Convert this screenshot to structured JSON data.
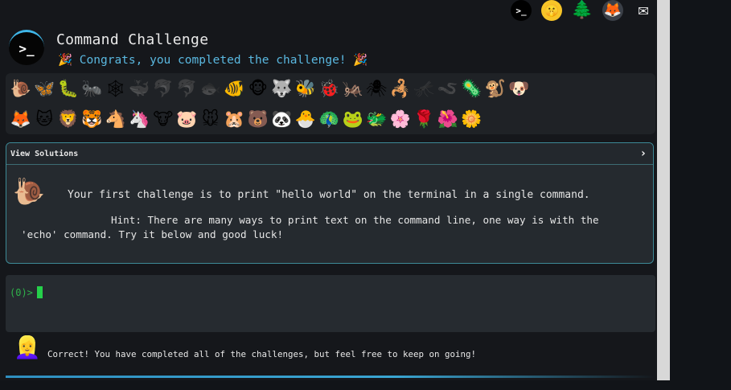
{
  "top_icons": {
    "terminal": ">_",
    "hush": "🤫",
    "tree": "🌲",
    "gitlab": "🦊",
    "mail": "✉"
  },
  "header": {
    "logo": ">_",
    "title": "Command Challenge",
    "congrats_emoji": "🎉",
    "congrats": "Congrats, you completed the challenge!"
  },
  "animals": {
    "row1": [
      "🐌",
      "🦋",
      "🐛",
      "🐜",
      "🕸",
      "🐳",
      "🐬",
      "🐬",
      "🐟",
      "🐠",
      "🐵",
      "🐺",
      "🐝",
      "🐞",
      "🦗",
      "🕷",
      "🦂",
      "🦟",
      "🪱",
      "🦠",
      "🐒",
      "🐶"
    ],
    "row2": [
      "🦊",
      "🐱",
      "🦁",
      "🐯",
      "🐴",
      "🦄",
      "🐮",
      "🐷",
      "🐭",
      "🐹",
      "🐻",
      "🐼",
      "🐣",
      "🦚",
      "🐸",
      "🐲",
      "🌸",
      "🌹",
      "🌺",
      "🌼"
    ],
    "dim_row1": [
      5,
      6,
      7,
      8,
      17,
      18
    ]
  },
  "solutions": {
    "title": "View Solutions",
    "chevron": "›",
    "snail": "🐌",
    "challenge": "Your first challenge is to print \"hello world\" on the terminal in a single command.",
    "hint": "Hint: There are many ways to print text on the command line, one way is with the 'echo' command. Try it below and good luck!"
  },
  "terminal": {
    "prompt": "(0)>"
  },
  "status": {
    "avatar": "👱‍♀️",
    "message": "Correct! You have completed all of the challenges, but feel free to keep on going!"
  }
}
